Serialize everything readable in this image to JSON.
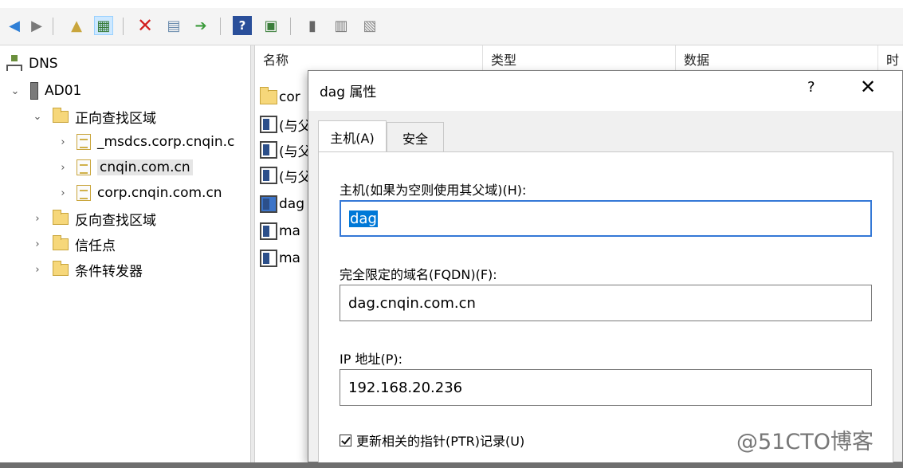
{
  "tree": {
    "root": "DNS",
    "server": "AD01",
    "forward": "正向查找区域",
    "zones": [
      "_msdcs.corp.cnqin.c",
      "cnqin.com.cn",
      "corp.cnqin.com.cn"
    ],
    "reverse": "反向查找区域",
    "trust": "信任点",
    "forwarders": "条件转发器"
  },
  "list": {
    "columns": [
      "名称",
      "类型",
      "数据",
      "时"
    ],
    "rows": [
      "cor",
      "(与父",
      "(与父",
      "(与父",
      "dag",
      "ma",
      "ma"
    ]
  },
  "dialog": {
    "title": "dag 属性",
    "help": "?",
    "close": "✕",
    "tabs": [
      "主机(A)",
      "安全"
    ],
    "host_label": "主机(如果为空则使用其父域)(H):",
    "host_value": "dag",
    "fqdn_label": "完全限定的域名(FQDN)(F):",
    "fqdn_value": "dag.cnqin.com.cn",
    "ip_label": "IP 地址(P):",
    "ip_value": "192.168.20.236",
    "ptr_label": "更新相关的指针(PTR)记录(U)",
    "ptr_checked": true
  },
  "toolbar": {
    "icons": [
      "back-icon",
      "forward-icon",
      "up-folder-icon",
      "show-hide-tree-icon",
      "delete-icon",
      "properties-icon",
      "export-icon",
      "help-icon",
      "console-icon",
      "server-icon",
      "list-icon",
      "clipboard-icon"
    ]
  },
  "watermark": "@51CTO博客",
  "colors": {
    "selection": "#0078d7",
    "folder": "#f6d77a",
    "tab_active": "#ffffff",
    "dialog_bg": "#f0f0f0"
  }
}
